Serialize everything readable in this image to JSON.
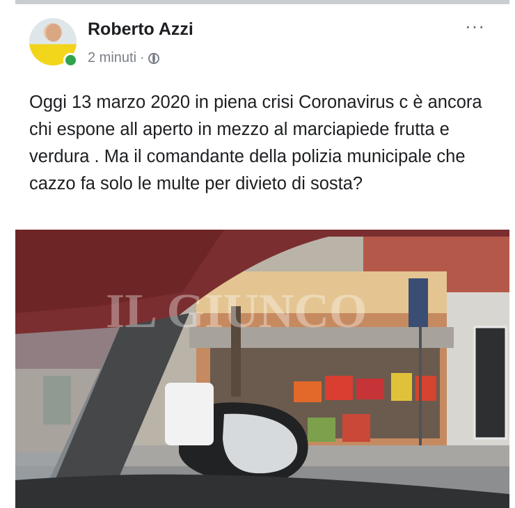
{
  "post": {
    "author": "Roberto Azzi",
    "time": "2 minuti",
    "separator": "·",
    "privacy_icon": "globe-icon",
    "more_icon": "more-options-icon",
    "more_label": "···",
    "text": "Oggi 13 marzo 2020 in piena crisi Coronavirus c è ancora chi espone all aperto in mezzo al marciapiede frutta e verdura . Ma il comandante della polizia municipale che cazzo fa solo le multe per divieto di sosta?",
    "online_status_color": "#31a24c"
  },
  "photo": {
    "watermark": "IL GIUNCO"
  }
}
